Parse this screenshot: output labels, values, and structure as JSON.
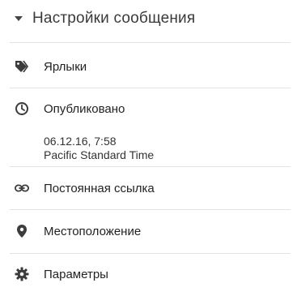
{
  "panel": {
    "title": "Настройки сообщения"
  },
  "rows": {
    "labels": {
      "label": "Ярлыки",
      "icon": "tag-icon"
    },
    "published": {
      "label": "Опубликовано",
      "icon": "clock-icon",
      "date": "06.12.16, 7:58",
      "timezone": "Pacific Standard Time"
    },
    "permalink": {
      "label": "Постоянная ссылка",
      "icon": "link-icon"
    },
    "location": {
      "label": "Местоположение",
      "icon": "location-pin-icon"
    },
    "options": {
      "label": "Параметры",
      "icon": "gear-icon"
    }
  },
  "colors": {
    "icon": "#3c3c3c",
    "divider": "#e3e3e3",
    "text": "#222222"
  }
}
